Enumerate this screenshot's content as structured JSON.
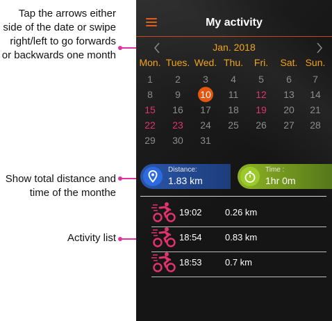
{
  "annotations": {
    "month_nav": "Tap the arrows either side of the date or swipe right/left to go forwards or backwards one month",
    "totals": "Show total distance and time of the monthe",
    "list": "Activity list"
  },
  "appbar": {
    "title": "My activity",
    "menu_icon": "hamburger-menu-icon"
  },
  "calendar": {
    "month": "Jan. 2018",
    "prev_icon": "chevron-left-icon",
    "next_icon": "chevron-right-icon",
    "weekdays": [
      "Mon.",
      "Tues.",
      "Wed.",
      "Thu.",
      "Fri.",
      "Sat.",
      "Sun."
    ],
    "weeks": [
      [
        "1",
        "2",
        "3",
        "4",
        "5",
        "6",
        "7"
      ],
      [
        "8",
        "9",
        "10",
        "11",
        "12",
        "13",
        "14"
      ],
      [
        "15",
        "16",
        "17",
        "18",
        "19",
        "20",
        "21"
      ],
      [
        "22",
        "23",
        "24",
        "25",
        "26",
        "27",
        "28"
      ],
      [
        "29",
        "30",
        "31",
        "",
        "",
        "",
        ""
      ]
    ],
    "highlight_red": [
      "12",
      "15",
      "19",
      "22",
      "23"
    ],
    "today": "10"
  },
  "summary": {
    "distance_label": "Distance:",
    "distance_value": "1.83 km",
    "time_label": "Time :",
    "time_value": "1hr 0m"
  },
  "activities": [
    {
      "time": "19:02",
      "distance": "0.26 km",
      "icon": "cycling-icon"
    },
    {
      "time": "18:54",
      "distance": "0.83 km",
      "icon": "cycling-icon"
    },
    {
      "time": "18:53",
      "distance": "0.7 km",
      "icon": "cycling-icon"
    }
  ],
  "colors": {
    "accent_orange": "#e5560f",
    "weekday_yellow": "#f2a418",
    "highlight_pink": "#e2336f",
    "annotation_pink": "#e0329a",
    "distance_blue": "#2c6be0",
    "time_green": "#9acb2a"
  }
}
